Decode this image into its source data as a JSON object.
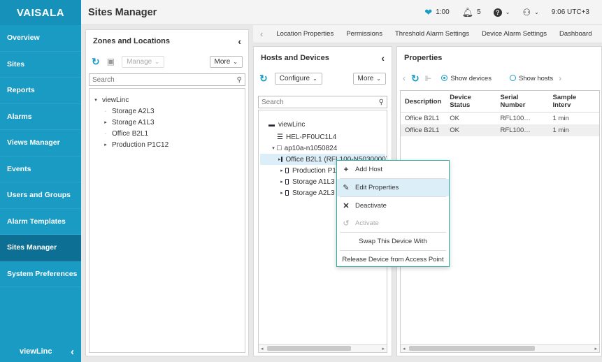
{
  "app": {
    "logo": "VAISALA",
    "footer": "viewLinc",
    "footer_icon": "‹"
  },
  "sidebar": {
    "items": [
      {
        "label": "Overview"
      },
      {
        "label": "Sites"
      },
      {
        "label": "Reports"
      },
      {
        "label": "Alarms"
      },
      {
        "label": "Views Manager"
      },
      {
        "label": "Events"
      },
      {
        "label": "Users and Groups"
      },
      {
        "label": "Alarm Templates"
      },
      {
        "label": "Sites Manager"
      },
      {
        "label": "System Preferences"
      }
    ],
    "active_index": 8
  },
  "topbar": {
    "title": "Sites Manager",
    "heart_value": "1:00",
    "bell_count": "5",
    "time": "9:06 UTC+3"
  },
  "zones": {
    "title": "Zones and Locations",
    "manage_label": "Manage",
    "more_label": "More",
    "search_placeholder": "Search",
    "tree": [
      {
        "label": "viewLinc",
        "level": 0,
        "toggle": "▾"
      },
      {
        "label": "Storage A2L3",
        "level": 1,
        "toggle": "·"
      },
      {
        "label": "Storage A1L3",
        "level": 1,
        "toggle": "▸"
      },
      {
        "label": "Office B2L1",
        "level": 1,
        "toggle": "·"
      },
      {
        "label": "Production P1C12",
        "level": 1,
        "toggle": "▸"
      }
    ]
  },
  "tabs": [
    "Location Properties",
    "Permissions",
    "Threshold Alarm Settings",
    "Device Alarm Settings",
    "Dashboard"
  ],
  "hosts": {
    "title": "Hosts and Devices",
    "configure_label": "Configure",
    "more_label": "More",
    "search_placeholder": "Search",
    "tree": [
      {
        "label": "viewLinc",
        "level": 0
      },
      {
        "label": "HEL-PF0UC1L4",
        "level": 1
      },
      {
        "label": "ap10a-n1050824",
        "level": 1
      },
      {
        "label": "Office B2L1 (RFL100-N5030000)",
        "level": 2
      },
      {
        "label": "Production P1",
        "level": 2
      },
      {
        "label": "Storage A1L3 (",
        "level": 2
      },
      {
        "label": "Storage A2L3 (",
        "level": 2
      }
    ]
  },
  "properties": {
    "title": "Properties",
    "show_devices": "Show devices",
    "show_hosts": "Show hosts",
    "columns": [
      "Description",
      "Device Status",
      "Serial Number",
      "Sample Interv"
    ],
    "rows": [
      [
        "Office B2L1",
        "OK",
        "RFL100…",
        "1 min"
      ],
      [
        "Office B2L1",
        "OK",
        "RFL100…",
        "1 min"
      ]
    ]
  },
  "context_menu": {
    "add_host": "Add Host",
    "edit_properties": "Edit Properties",
    "deactivate": "Deactivate",
    "activate": "Activate",
    "swap": "Swap This Device With",
    "release": "Release Device from Access Point"
  },
  "colors": {
    "sidebar": "#1a9bc4",
    "active": "#0d6f94",
    "accent": "#2bb0a5"
  }
}
